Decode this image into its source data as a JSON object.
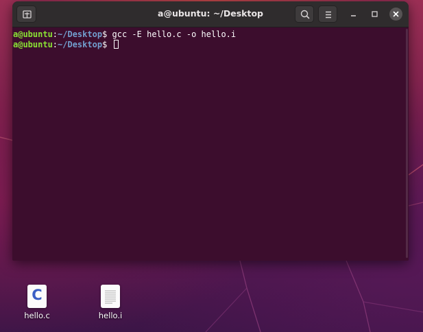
{
  "window": {
    "title": "a@ubuntu: ~/Desktop"
  },
  "terminal": {
    "lines": [
      {
        "user": "a@ubuntu",
        "sep": ":",
        "path": "~/Desktop",
        "sym": "$ ",
        "command": "gcc -E hello.c -o hello.i"
      },
      {
        "user": "a@ubuntu",
        "sep": ":",
        "path": "~/Desktop",
        "sym": "$ ",
        "command": ""
      }
    ]
  },
  "desktop": {
    "icons": [
      {
        "label": "hello.c",
        "glyph": "C",
        "type": "c-source-icon"
      },
      {
        "label": "hello.i",
        "type": "text-document-icon"
      }
    ]
  },
  "colors": {
    "prompt_user": "#8ae234",
    "prompt_path": "#729fcf",
    "terminal_bg": "#3c0d2d",
    "titlebar_bg": "#2f2c2d",
    "c_icon_blue": "#3b5fc5"
  }
}
